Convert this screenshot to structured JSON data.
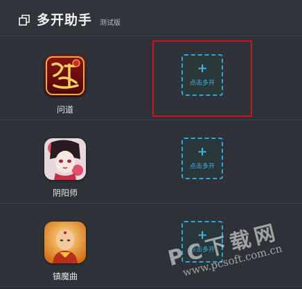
{
  "header": {
    "title": "多开助手",
    "subtitle": "测试版",
    "icon": "window-copy-icon"
  },
  "apps": [
    {
      "name": "问道",
      "icon": "wendao-app-icon",
      "clone_label": "点击多开"
    },
    {
      "name": "阴阳师",
      "icon": "yinyangshi-app-icon",
      "clone_label": "点击多开"
    },
    {
      "name": "镇魔曲",
      "icon": "zhenmoqu-app-icon",
      "clone_label": "点击多开"
    }
  ],
  "clone_plus": "+",
  "watermark": {
    "text": "PC下载网",
    "url": "www.pcsoft.com.cn"
  },
  "colors": {
    "accent": "#39b4e6",
    "highlight": "#d0121a",
    "background": "#2b2f35"
  }
}
